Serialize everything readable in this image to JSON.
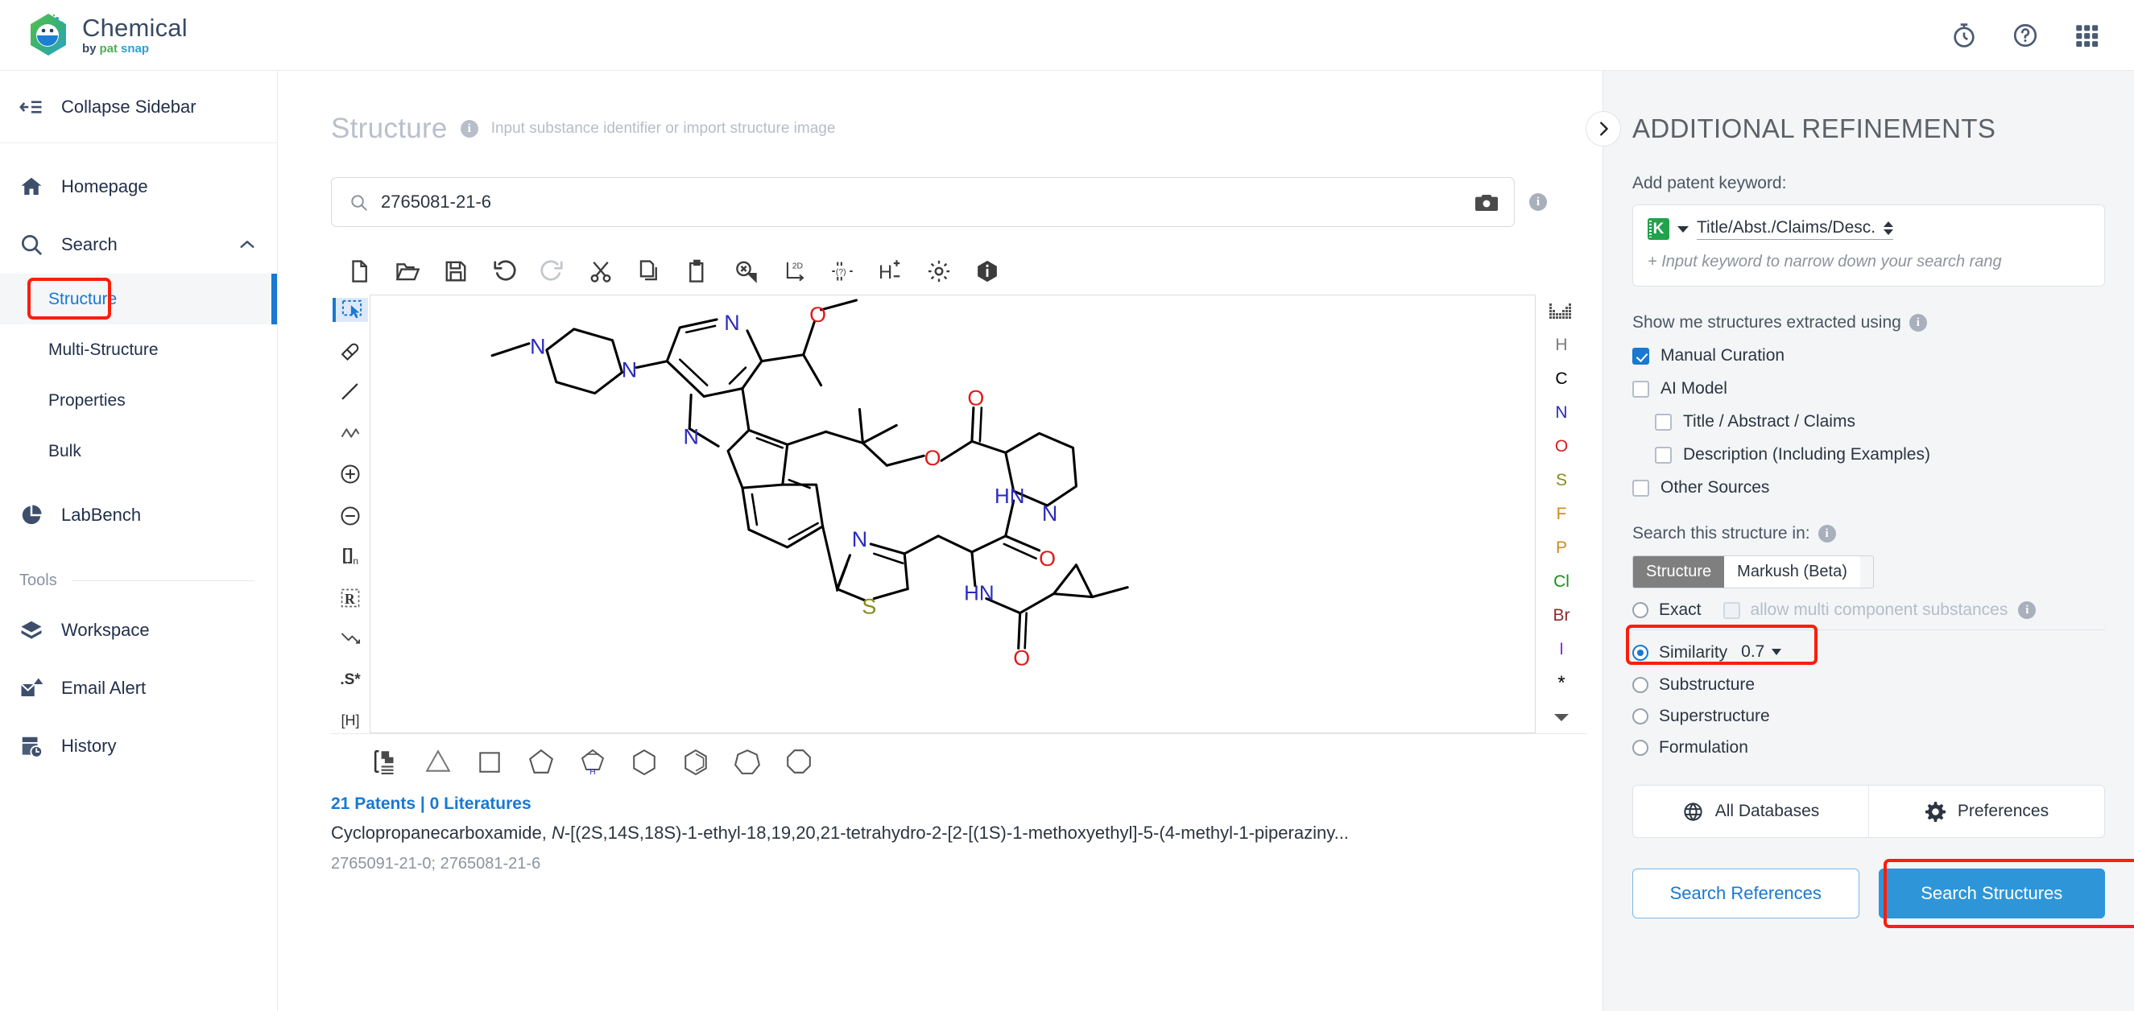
{
  "brand": {
    "name": "Chemical",
    "by": "by",
    "pat": "pat",
    "snap": "snap"
  },
  "topbar": {
    "icons": [
      {
        "name": "timer-icon",
        "label": "Timer"
      },
      {
        "name": "help-icon",
        "label": "Help"
      },
      {
        "name": "apps-grid-icon",
        "label": "Apps"
      }
    ]
  },
  "sidebar": {
    "collapse_label": "Collapse Sidebar",
    "items": [
      {
        "label": "Homepage",
        "icon": "home-icon"
      },
      {
        "label": "Search",
        "icon": "search-icon",
        "expanded": true
      }
    ],
    "search_children": [
      {
        "label": "Structure",
        "active": true
      },
      {
        "label": "Multi-Structure",
        "active": false
      },
      {
        "label": "Properties",
        "active": false
      },
      {
        "label": "Bulk",
        "active": false
      }
    ],
    "labbench": {
      "label": "LabBench",
      "icon": "chart-pie-icon"
    },
    "tools_header": "Tools",
    "tools": [
      {
        "label": "Workspace",
        "icon": "workspace-cube-icon"
      },
      {
        "label": "Email Alert",
        "icon": "email-alert-icon"
      },
      {
        "label": "History",
        "icon": "history-icon"
      }
    ]
  },
  "main": {
    "title": "Structure",
    "hint": "Input substance identifier or import structure image",
    "search": {
      "value": "2765081-21-6",
      "placeholder": "Input substance identifier"
    },
    "toolbar": [
      {
        "name": "new-file-icon",
        "label": "New"
      },
      {
        "name": "open-folder-icon",
        "label": "Open"
      },
      {
        "name": "save-icon",
        "label": "Save"
      },
      {
        "name": "undo-icon",
        "label": "Undo"
      },
      {
        "name": "redo-icon",
        "label": "Redo",
        "disabled": true
      },
      {
        "name": "cut-icon",
        "label": "Cut"
      },
      {
        "name": "copy-icon",
        "label": "Copy"
      },
      {
        "name": "paste-icon",
        "label": "Paste"
      },
      {
        "name": "zoom-select-icon",
        "label": "Select/Zoom"
      },
      {
        "name": "layout-2d-icon",
        "label": "2D Layout"
      },
      {
        "name": "query-properties-icon",
        "label": "Query Properties"
      },
      {
        "name": "hydrogen-toggle-icon",
        "label": "Add/Remove Hydrogens"
      },
      {
        "name": "settings-gear-icon",
        "label": "Settings"
      },
      {
        "name": "info-icon",
        "label": "About"
      }
    ],
    "left_tools": [
      {
        "name": "select-rectangle-tool",
        "label": "Select",
        "active": true
      },
      {
        "name": "eraser-tool",
        "label": "Erase"
      },
      {
        "name": "bond-single-tool",
        "label": "Single Bond"
      },
      {
        "name": "chain-tool",
        "label": "Chain"
      },
      {
        "name": "charge-plus-tool",
        "label": "Charge +"
      },
      {
        "name": "charge-minus-tool",
        "label": "Charge -"
      },
      {
        "name": "repeat-group-tool",
        "label": "[ ]n"
      },
      {
        "name": "r-group-tool",
        "label": "R"
      },
      {
        "name": "reaction-arrow-tool",
        "label": "Reaction"
      },
      {
        "name": "stereo-tool",
        "label": ".S*"
      },
      {
        "name": "explicit-hydrogen-tool",
        "label": "[H]"
      }
    ],
    "elements": [
      {
        "symbol": "H",
        "color": "#7c7c7c"
      },
      {
        "symbol": "C",
        "color": "#000000"
      },
      {
        "symbol": "N",
        "color": "#2b2bbf"
      },
      {
        "symbol": "O",
        "color": "#e01b1b"
      },
      {
        "symbol": "S",
        "color": "#8a8a1a"
      },
      {
        "symbol": "F",
        "color": "#d08a1e"
      },
      {
        "symbol": "P",
        "color": "#d08a1e"
      },
      {
        "symbol": "Cl",
        "color": "#169116"
      },
      {
        "symbol": "Br",
        "color": "#8b2b2b"
      },
      {
        "symbol": "I",
        "color": "#8a2be2"
      },
      {
        "symbol": "*",
        "color": "#000000"
      }
    ],
    "rings": [
      {
        "name": "template-library-icon",
        "label": "Templates"
      },
      {
        "name": "cyclopropane-icon",
        "label": "Cyclopropane"
      },
      {
        "name": "cyclobutane-icon",
        "label": "Cyclobutane"
      },
      {
        "name": "cyclopentane-icon",
        "label": "Cyclopentane"
      },
      {
        "name": "pyrrole-icon",
        "label": "Pyrrole"
      },
      {
        "name": "cyclohexane-icon",
        "label": "Cyclohexane"
      },
      {
        "name": "benzene-icon",
        "label": "Benzene"
      },
      {
        "name": "cycloheptane-icon",
        "label": "Cycloheptane"
      },
      {
        "name": "cyclooctane-icon",
        "label": "Cyclooctane"
      }
    ],
    "results": {
      "counts": "21 Patents | 0 Literatures",
      "name_prefix": "Cyclopropanecarboxamide, ",
      "name_italic_n": "N",
      "name_rest": "-[(2S,14S,18S)-1-ethyl-18,19,20,21-tetrahydro-2-[2-[(1S)-1-methoxyethyl]-5-(4-methyl-1-piperaziny...",
      "cas": "2765091-21-0; 2765081-21-6"
    }
  },
  "panel": {
    "title": "ADDITIONAL REFINEMENTS",
    "keyword_label": "Add patent keyword:",
    "keyword_field": "Title/Abst./Claims/Desc.",
    "keyword_placeholder": "+ Input keyword to narrow down your search rang",
    "extracted_label": "Show me structures extracted using",
    "extracted_options": [
      {
        "label": "Manual Curation",
        "checked": true,
        "indent": false
      },
      {
        "label": "AI Model",
        "checked": false,
        "indent": false
      },
      {
        "label": "Title / Abstract / Claims",
        "checked": false,
        "indent": true
      },
      {
        "label": "Description (Including Examples)",
        "checked": false,
        "indent": true
      },
      {
        "label": "Other Sources",
        "checked": false,
        "indent": false
      }
    ],
    "search_in_label": "Search this structure in:",
    "segments": [
      {
        "label": "Structure",
        "on": true
      },
      {
        "label": "Markush (Beta)",
        "on": false
      }
    ],
    "search_modes": [
      {
        "label": "Exact",
        "selected": false
      },
      {
        "label": "Similarity",
        "selected": true,
        "value": "0.7"
      },
      {
        "label": "Substructure",
        "selected": false
      },
      {
        "label": "Superstructure",
        "selected": false
      },
      {
        "label": "Formulation",
        "selected": false
      }
    ],
    "multi_component_label": "allow multi component substances",
    "databases_label": "All Databases",
    "preferences_label": "Preferences",
    "search_references_label": "Search References",
    "search_structures_label": "Search Structures"
  },
  "colors": {
    "accent_blue": "#1878d2",
    "primary_button": "#2e96d8",
    "highlight_red": "#fc1d0b",
    "panel_bg": "#f3f5f7"
  }
}
